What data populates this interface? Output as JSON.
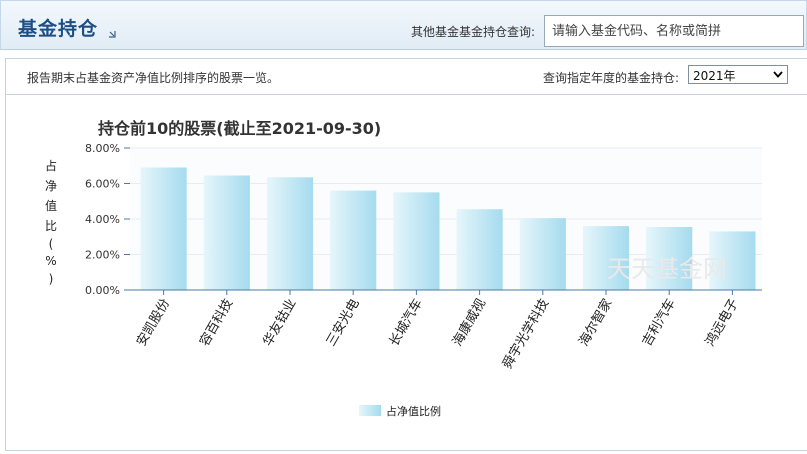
{
  "header": {
    "title": "基金持仓",
    "query_label": "其他基金基金持仓查询:",
    "query_placeholder": "请输入基金代码、名称或简拼"
  },
  "filter": {
    "description": "报告期末占基金资产净值比例排序的股票一览。",
    "year_label": "查询指定年度的基金持仓:",
    "year_selected": "2021年"
  },
  "watermark": "天天基金网",
  "chart_data": {
    "type": "bar",
    "title": "持仓前10的股票(截止至2021-09-30)",
    "ylabel": "占净值比(%)",
    "ylabel_chars": [
      "占",
      "净",
      "值",
      "比",
      "(",
      "%",
      ")"
    ],
    "categories": [
      "安凯股份",
      "容百科技",
      "华友钴业",
      "三安光电",
      "长城汽车",
      "海康威视",
      "舜宇光学科技",
      "海尔智家",
      "吉利汽车",
      "鸿远电子"
    ],
    "series": [
      {
        "name": "占净值比例",
        "values": [
          6.9,
          6.45,
          6.35,
          5.6,
          5.5,
          4.55,
          4.05,
          3.6,
          3.55,
          3.3
        ]
      }
    ],
    "ylim": [
      0,
      8
    ],
    "yticks": [
      "0.00%",
      "2.00%",
      "4.00%",
      "6.00%",
      "8.00%"
    ],
    "grid": true,
    "legend_position": "bottom-center",
    "colors": {
      "bar_light": "#e6f6fb",
      "bar_dark": "#a5dbee",
      "axis": "#4a78a8"
    }
  }
}
